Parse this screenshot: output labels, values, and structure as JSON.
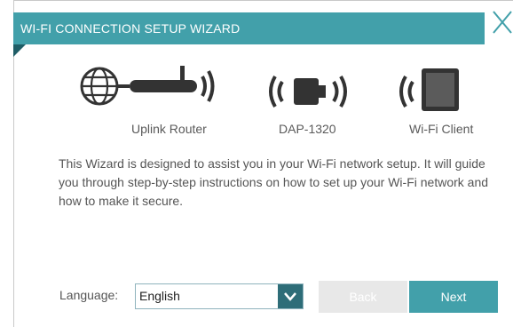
{
  "wizard": {
    "title": "WI-FI CONNECTION SETUP WIZARD",
    "close_icon": "close-icon"
  },
  "devices": [
    {
      "label": "Uplink Router",
      "icon": "router-icon"
    },
    {
      "label": "DAP-1320",
      "icon": "extender-icon"
    },
    {
      "label": "Wi-Fi Client",
      "icon": "tablet-icon"
    }
  ],
  "description": "This Wizard is designed to assist you in your Wi-Fi network setup. It will guide you through step-by-step instructions on how to set up your Wi-Fi network and how to make it secure.",
  "language": {
    "label": "Language:",
    "selected": "English"
  },
  "buttons": {
    "back_label": "Back",
    "next_label": "Next"
  },
  "colors": {
    "accent": "#42a0aa",
    "dark_accent": "#2e6d78",
    "icon": "#333333"
  }
}
